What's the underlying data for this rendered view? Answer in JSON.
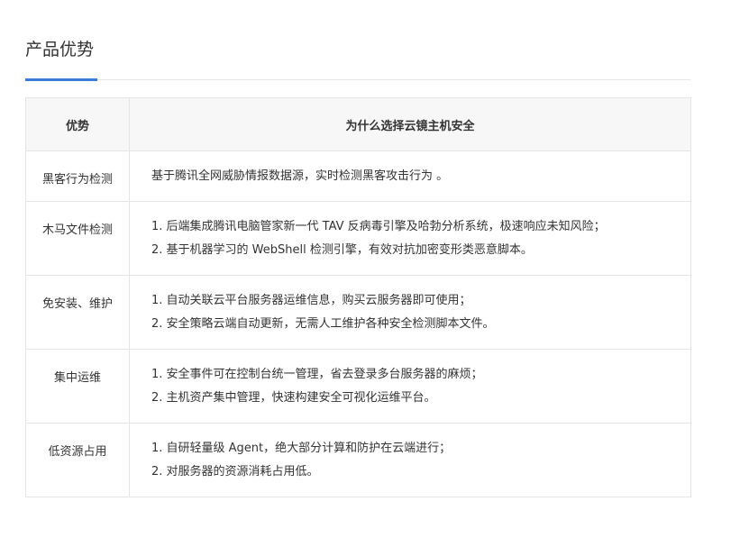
{
  "section": {
    "title": "产品优势"
  },
  "table": {
    "headers": [
      "优势",
      "为什么选择云镜主机安全"
    ],
    "rows": [
      {
        "name": "黑客行为检测",
        "lines": [
          "基于腾讯全网威胁情报数据源，实时检测黑客攻击行为 。"
        ]
      },
      {
        "name": "木马文件检测",
        "lines": [
          "1. 后端集成腾讯电脑管家新一代 TAV 反病毒引擎及哈勃分析系统，极速响应未知风险；",
          "2. 基于机器学习的 WebShell 检测引擎，有效对抗加密变形类恶意脚本。"
        ]
      },
      {
        "name": "免安装、维护",
        "lines": [
          "1. 自动关联云平台服务器运维信息，购买云服务器即可使用；",
          "2. 安全策略云端自动更新，无需人工维护各种安全检测脚本文件。"
        ]
      },
      {
        "name": "集中运维",
        "lines": [
          "1. 安全事件可在控制台统一管理，省去登录多台服务器的麻烦；",
          "2. 主机资产集中管理，快速构建安全可视化运维平台。"
        ]
      },
      {
        "name": "低资源占用",
        "lines": [
          "1. 自研轻量级 Agent，绝大部分计算和防护在云端进行；",
          "2. 对服务器的资源消耗占用低。"
        ]
      }
    ]
  }
}
